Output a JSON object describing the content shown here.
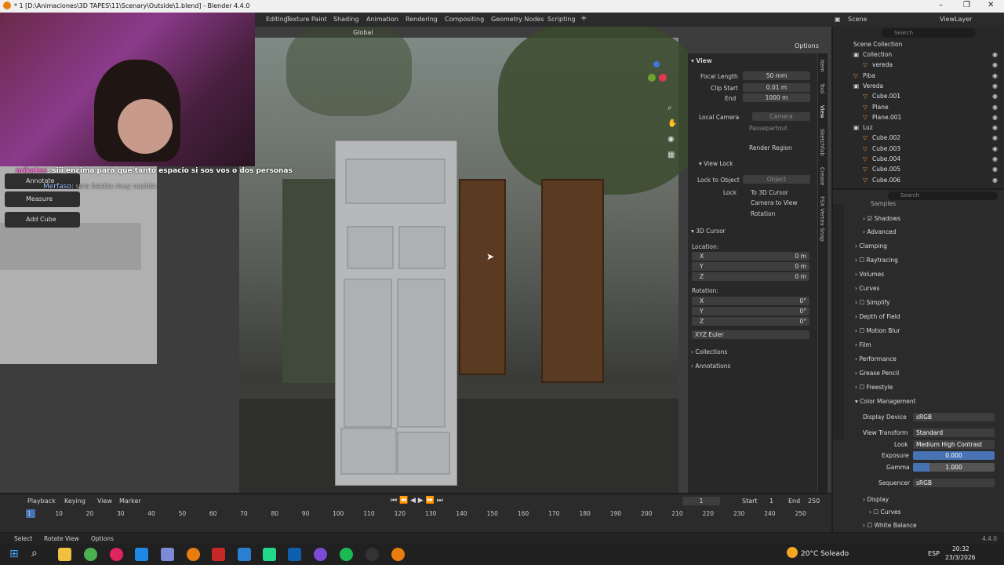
{
  "window": {
    "title": "* 1 [D:\\Animaciones\\3D TAPES\\11\\Scenary\\Outside\\1.blend] - Blender 4.4.0"
  },
  "workspaces": [
    "Editing",
    "Texture Paint",
    "Shading",
    "Animation",
    "Rendering",
    "Compositing",
    "Geometry Nodes",
    "Scripting"
  ],
  "header": {
    "scene": "Scene",
    "view_layer": "ViewLayer",
    "transform": "Global",
    "options": "Options",
    "search_placeholder": "Search"
  },
  "chat": [
    {
      "user": "mikatss",
      "message": "siii encima para qué tanto espacio si sos vos o dos personas"
    },
    {
      "user": "Merfaso",
      "message": "una bestia muy nazida"
    }
  ],
  "tools": [
    "Annotate",
    "Measure",
    "Add Cube"
  ],
  "npanel": {
    "view_header": "View",
    "focal_length_label": "Focal Length",
    "focal_length": "50 mm",
    "clip_start_label": "Clip Start",
    "clip_start": "0.01 m",
    "end_label": "End",
    "end": "1000 m",
    "local_camera_label": "Local Camera",
    "local_camera": "Camera",
    "passepartout": "Passepartout",
    "render_region": "Render Region",
    "view_lock_header": "View Lock",
    "lock_to_object_label": "Lock to Object",
    "object_placeholder": "Object",
    "lock_label": "Lock",
    "lock_3d_cursor": "To 3D Cursor",
    "camera_to_view": "Camera to View",
    "rotation_lock": "Rotation",
    "cursor_header": "3D Cursor",
    "location_label": "Location:",
    "x": "X",
    "y": "Y",
    "z": "Z",
    "loc_x": "0 m",
    "loc_y": "0 m",
    "loc_z": "0 m",
    "rotation_label": "Rotation:",
    "rot_x": "0°",
    "rot_y": "0°",
    "rot_z": "0°",
    "rotation_mode": "XYZ Euler",
    "collections": "Collections",
    "annotations": "Annotations"
  },
  "sidebar_tabs": [
    "Item",
    "Tool",
    "View",
    "Sketchfab",
    "Create",
    "FSX Vertex Snap"
  ],
  "outliner": {
    "root": "Scene Collection",
    "items": [
      {
        "name": "Collection",
        "type": "collection"
      },
      {
        "name": "vereda",
        "type": "object"
      },
      {
        "name": "Piba",
        "type": "object"
      },
      {
        "name": "Vereda",
        "type": "collection"
      },
      {
        "name": "Cube.001",
        "type": "object"
      },
      {
        "name": "Plane",
        "type": "object"
      },
      {
        "name": "Plane.001",
        "type": "object"
      },
      {
        "name": "Luz",
        "type": "collection"
      },
      {
        "name": "Cube.002",
        "type": "object"
      },
      {
        "name": "Cube.003",
        "type": "object"
      },
      {
        "name": "Cube.004",
        "type": "object"
      },
      {
        "name": "Cube.005",
        "type": "object"
      },
      {
        "name": "Cube.006",
        "type": "object"
      }
    ]
  },
  "properties": {
    "samples": "Samples",
    "shadows": "Shadows",
    "advanced": "Advanced",
    "clamping": "Clamping",
    "raytracing": "Raytracing",
    "volumes": "Volumes",
    "curves": "Curves",
    "simplify": "Simplify",
    "depth_of_field": "Depth of Field",
    "motion_blur": "Motion Blur",
    "film": "Film",
    "performance": "Performance",
    "grease_pencil": "Grease Pencil",
    "freestyle": "Freestyle",
    "color_management": "Color Management",
    "display_device_label": "Display Device",
    "display_device": "sRGB",
    "view_transform_label": "View Transform",
    "view_transform": "Standard",
    "look_label": "Look",
    "look": "Medium High Contrast",
    "exposure_label": "Exposure",
    "exposure": "0.000",
    "gamma_label": "Gamma",
    "gamma": "1.000",
    "sequencer_label": "Sequencer",
    "sequencer": "sRGB",
    "display": "Display",
    "curves2": "Curves",
    "white_balance": "White Balance"
  },
  "timeline": {
    "playback": "Playback",
    "keying": "Keying",
    "view": "View",
    "marker": "Marker",
    "current_frame": "1",
    "start_label": "Start",
    "start": "1",
    "end_label": "End",
    "end": "250",
    "ticks": [
      "1",
      "10",
      "20",
      "30",
      "40",
      "50",
      "60",
      "70",
      "80",
      "90",
      "100",
      "110",
      "120",
      "130",
      "140",
      "150",
      "160",
      "170",
      "180",
      "190",
      "200",
      "210",
      "220",
      "230",
      "240",
      "250"
    ]
  },
  "status": {
    "select": "Select",
    "rotate_view": "Rotate View",
    "options": "Options",
    "version": "4.4.0"
  },
  "taskbar": {
    "weather": "20°C  Soleado",
    "lang": "ESP",
    "time": "20:32",
    "date": "23/3/2026"
  }
}
